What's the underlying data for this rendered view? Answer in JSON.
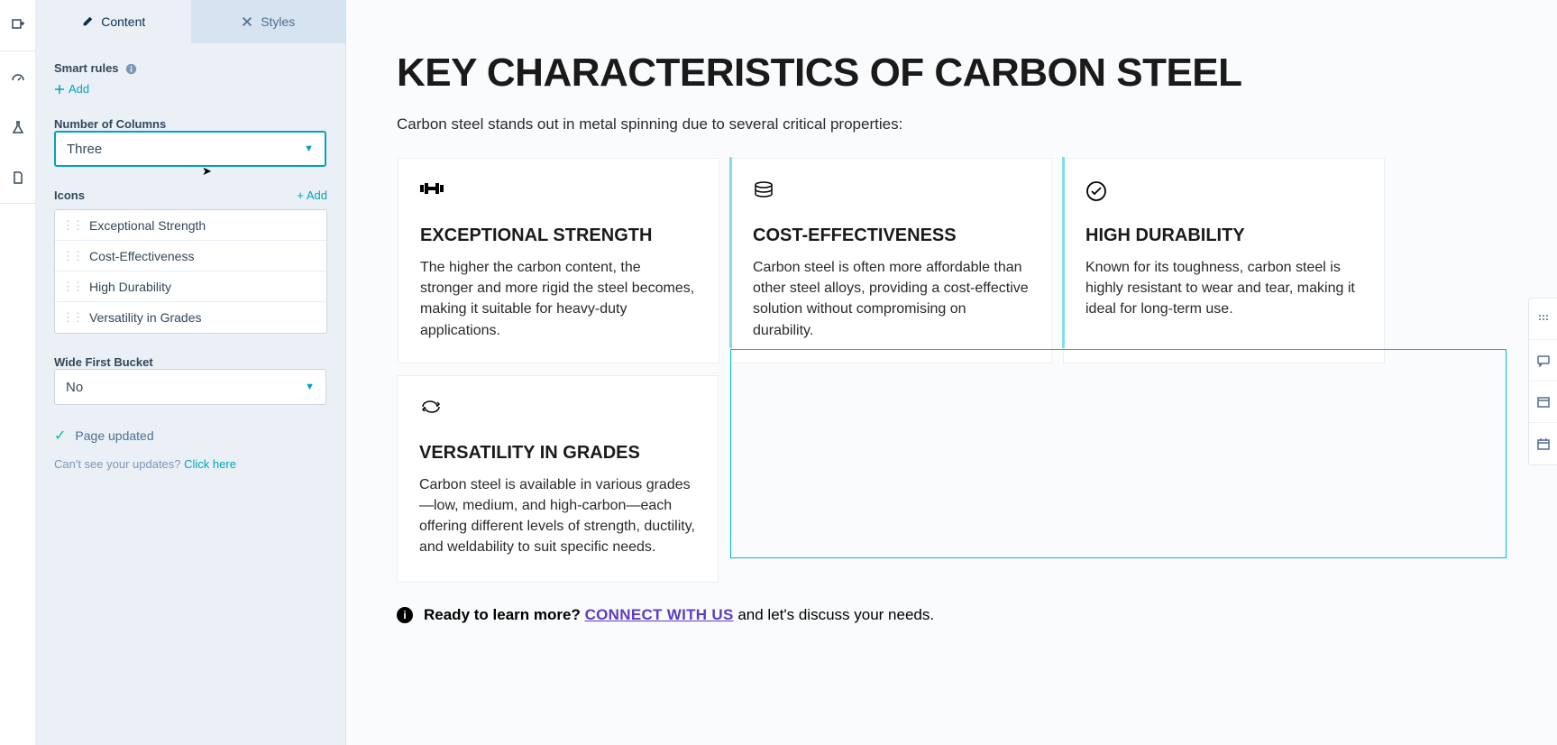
{
  "tabs": {
    "content": "Content",
    "styles": "Styles"
  },
  "smartRules": {
    "label": "Smart rules",
    "add": "Add"
  },
  "columns": {
    "label": "Number of Columns",
    "value": "Three"
  },
  "icons": {
    "label": "Icons",
    "add": "+ Add",
    "items": [
      "Exceptional Strength",
      "Cost-Effectiveness",
      "High Durability",
      "Versatility in Grades"
    ]
  },
  "wideFirst": {
    "label": "Wide First Bucket",
    "value": "No"
  },
  "status": "Page updated",
  "hint": {
    "text": "Can't see your updates? ",
    "link": "Click here"
  },
  "page": {
    "heading": "KEY CHARACTERISTICS OF CARBON STEEL",
    "lead": "Carbon steel stands out in metal spinning due to several critical properties:",
    "cards": [
      {
        "title": "EXCEPTIONAL STRENGTH",
        "body": "The higher the carbon content, the stronger and more rigid the steel becomes, making it suitable for heavy-duty applications."
      },
      {
        "title": "COST-EFFECTIVENESS",
        "body": "Carbon steel is often more affordable than other steel alloys, providing a cost-effective solution without compromising on durability."
      },
      {
        "title": "HIGH DURABILITY",
        "body": "Known for its toughness, carbon steel is highly resistant to wear and tear, making it ideal for long-term use."
      },
      {
        "title": "VERSATILITY IN GRADES",
        "body": "Carbon steel is available in various grades—low, medium, and high-carbon—each offering different levels of strength, ductility, and weldability to suit specific needs."
      }
    ],
    "footer": {
      "bold": "Ready to learn more?",
      "link": "CONNECT WITH US",
      "rest": " and let's discuss your needs."
    }
  }
}
